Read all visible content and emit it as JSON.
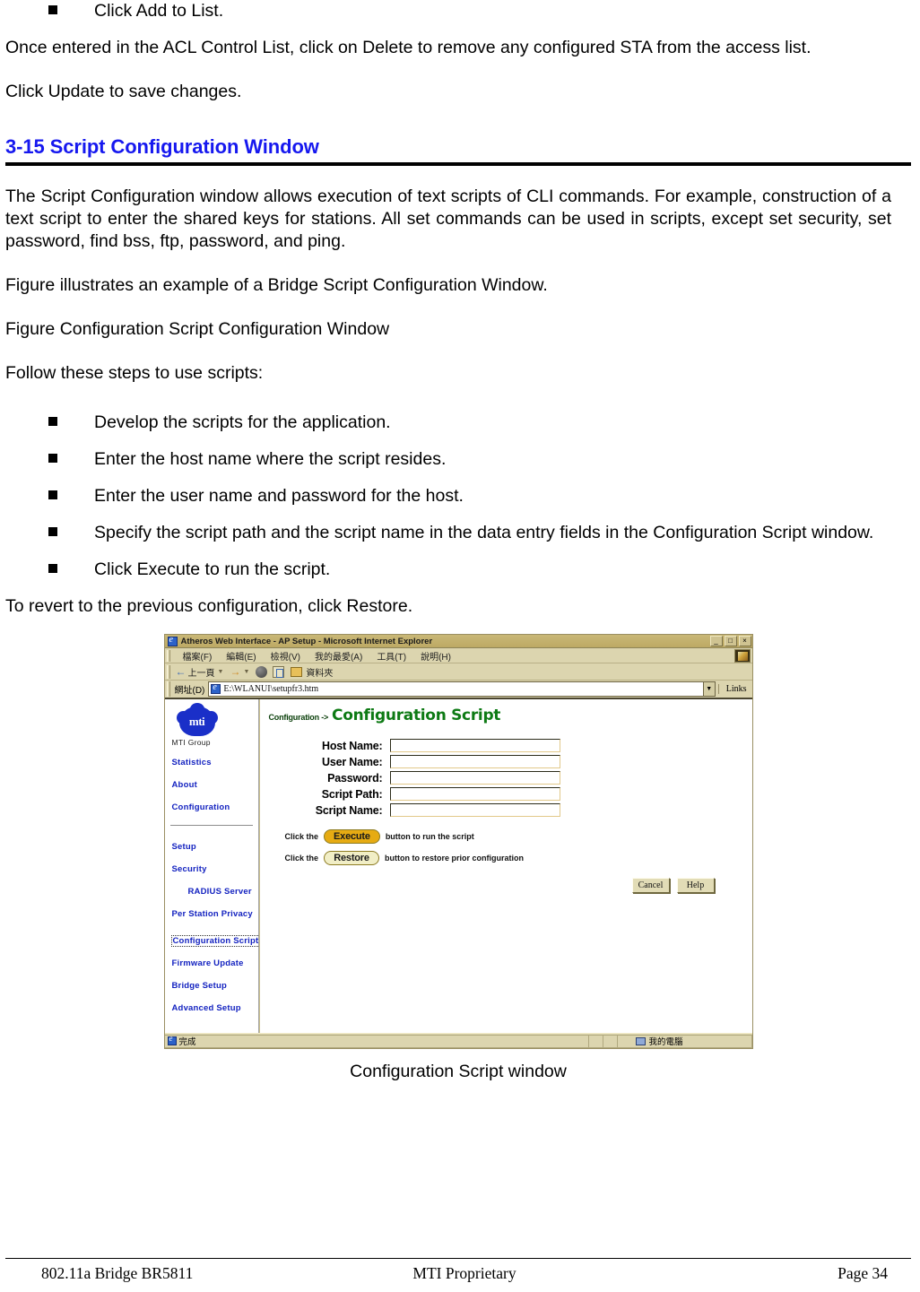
{
  "document": {
    "top_bullet": "Click Add to List.",
    "para1": "Once entered in the ACL Control List, click on Delete to remove any configured STA from the access list.",
    "para2": "Click Update to save changes.",
    "section_heading": "3-15 Script Configuration Window",
    "para3": "The Script Configuration window allows execution of text scripts of CLI commands. For example, construction of a text script to enter the shared keys for stations. All set commands can be used in scripts, except set security, set password, find bss, ftp, password, and ping.",
    "para4": "Figure illustrates an example of a Bridge Script Configuration Window.",
    "para5": "Figure Configuration Script Configuration Window",
    "para6": "Follow these steps to use scripts:",
    "steps": [
      "Develop the scripts for the application.",
      "Enter the host name where the script resides.",
      "Enter the user name and password for the host.",
      "Specify the script path and the script name in the data entry fields in the Configuration Script window.",
      "Click Execute to run the script."
    ],
    "para7": "To revert to the previous configuration, click Restore.",
    "figure_caption": "Configuration Script window"
  },
  "browser": {
    "title": "Atheros Web Interface - AP Setup - Microsoft Internet Explorer",
    "window_buttons": {
      "minimize": "_",
      "restore": "□",
      "close": "×"
    },
    "menu": [
      "檔案(F)",
      "編輯(E)",
      "檢視(V)",
      "我的最愛(A)",
      "工具(T)",
      "說明(H)"
    ],
    "toolbar": {
      "back": "上一頁",
      "folders": "資料夾"
    },
    "address": {
      "label": "網址(D)",
      "value": "E:\\WLANUI\\setupfr3.htm",
      "links_label": "Links"
    },
    "status": {
      "left": "完成",
      "right": "我的電腦"
    }
  },
  "sidebar": {
    "logo_word": "mti",
    "logo_caption": "MTI Group",
    "group1": [
      {
        "label": "Statistics",
        "selected": false
      },
      {
        "label": "About",
        "selected": false
      },
      {
        "label": "Configuration",
        "selected": false
      }
    ],
    "group2": [
      {
        "label": "Setup",
        "selected": false,
        "indent": false
      },
      {
        "label": "Security",
        "selected": false,
        "indent": false
      },
      {
        "label": "RADIUS Server",
        "selected": false,
        "indent": true
      },
      {
        "label": "Per Station Privacy",
        "selected": false,
        "indent": false
      },
      {
        "label": "Configuration Script",
        "selected": true,
        "indent": false
      },
      {
        "label": "Firmware Update",
        "selected": false,
        "indent": false
      },
      {
        "label": "Bridge Setup",
        "selected": false,
        "indent": false
      },
      {
        "label": "Advanced Setup",
        "selected": false,
        "indent": false
      }
    ]
  },
  "page": {
    "breadcrumb_prefix": "Configuration ->",
    "breadcrumb_title": "Configuration Script",
    "fields": [
      {
        "label": "Host Name:",
        "value": ""
      },
      {
        "label": "User Name:",
        "value": ""
      },
      {
        "label": "Password:",
        "value": ""
      },
      {
        "label": "Script Path:",
        "value": ""
      },
      {
        "label": "Script Name:",
        "value": ""
      }
    ],
    "action_lines": [
      {
        "pre": "Click the",
        "button": "Execute",
        "post": "button to run the script",
        "style": "execute"
      },
      {
        "pre": "Click the",
        "button": "Restore",
        "post": "button to restore prior configuration",
        "style": "restore"
      }
    ],
    "small_buttons": [
      "Cancel",
      "Help"
    ]
  },
  "footer": {
    "left": "802.11a Bridge BR5811",
    "center": "MTI Proprietary",
    "right": "Page 34"
  },
  "colors": {
    "heading_blue": "#1618ef",
    "link_blue": "#1322c0",
    "breadcrumb_green": "#0d7a14",
    "execute_gold": "#e6ab13",
    "restore_cream": "#f1eec6",
    "chrome_tan": "#dcd5af"
  }
}
